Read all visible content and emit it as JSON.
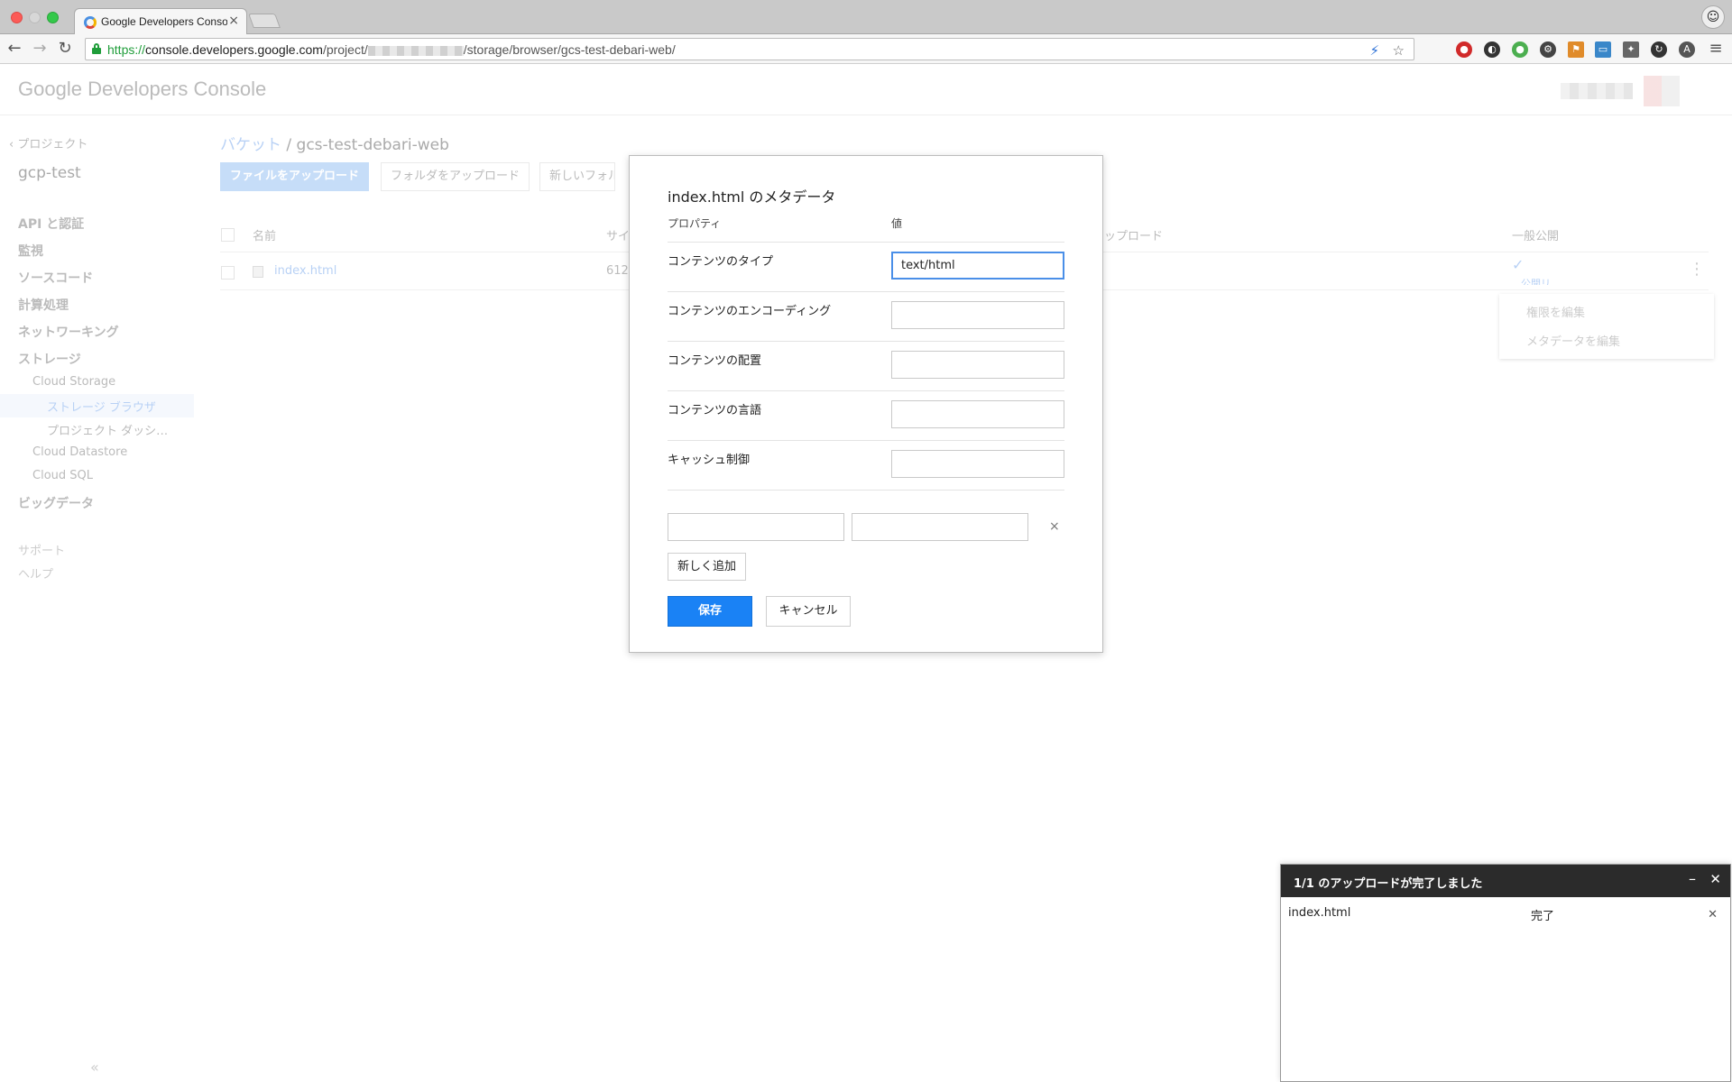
{
  "browser": {
    "tab_title": "Google Developers Console",
    "url": {
      "scheme": "https://",
      "host": "console.developers.google.com",
      "path_before": "/project/",
      "path_after": "/storage/browser/gcs-test-debari-web/"
    }
  },
  "header": {
    "logo_google": "Google",
    "logo_product": "Developers Console"
  },
  "sidebar": {
    "back": "‹ プロジェクト",
    "project": "gcp-test",
    "items": [
      {
        "label": "API と認証"
      },
      {
        "label": "監視"
      },
      {
        "label": "ソースコード"
      },
      {
        "label": "計算処理"
      },
      {
        "label": "ネットワーキング"
      },
      {
        "label": "ストレージ"
      }
    ],
    "storage_children": {
      "cloud_storage": "Cloud Storage",
      "storage_browser": "ストレージ ブラウザ",
      "project_dashboard": "プロジェクト ダッシ…",
      "cloud_datastore": "Cloud Datastore",
      "cloud_sql": "Cloud SQL"
    },
    "bigdata": "ビッグデータ",
    "support": "サポート",
    "help": "ヘルプ",
    "collapse": "«"
  },
  "main": {
    "breadcrumb": {
      "bucket": "バケット",
      "separator": "/",
      "current": "gcs-test-debari-web"
    },
    "buttons": {
      "upload_files": "ファイルをアップロード",
      "upload_folder": "フォルダをアップロード",
      "new_folder": "新しいフォルダ"
    },
    "table": {
      "headers": {
        "name": "名前",
        "size": "サイ",
        "uploaded": "ップロード",
        "public": "一般公開"
      },
      "rows": [
        {
          "name": "index.html",
          "size": "612",
          "public_check": "✓",
          "public_link": "公開リ"
        }
      ]
    },
    "context_menu": {
      "edit_permissions": "権限を編集",
      "edit_metadata": "メタデータを編集"
    }
  },
  "dialog": {
    "title": "index.html のメタデータ",
    "col_property": "プロパティ",
    "col_value": "値",
    "rows": [
      {
        "label": "コンテンツのタイプ",
        "value": "text/html"
      },
      {
        "label": "コンテンツのエンコーディング",
        "value": ""
      },
      {
        "label": "コンテンツの配置",
        "value": ""
      },
      {
        "label": "コンテンツの言語",
        "value": ""
      },
      {
        "label": "キャッシュ制御",
        "value": ""
      }
    ],
    "remove": "×",
    "add_new": "新しく追加",
    "save": "保存",
    "cancel": "キャンセル"
  },
  "upload_panel": {
    "title": "1/1 のアップロードが完了しました",
    "minimize": "–",
    "close": "✕",
    "file": "index.html",
    "status": "完了",
    "row_close": "✕"
  },
  "colors": {
    "primary": "#1a82f5",
    "secure_green": "#1f9d3a",
    "panel_header": "#2b2b2b"
  }
}
